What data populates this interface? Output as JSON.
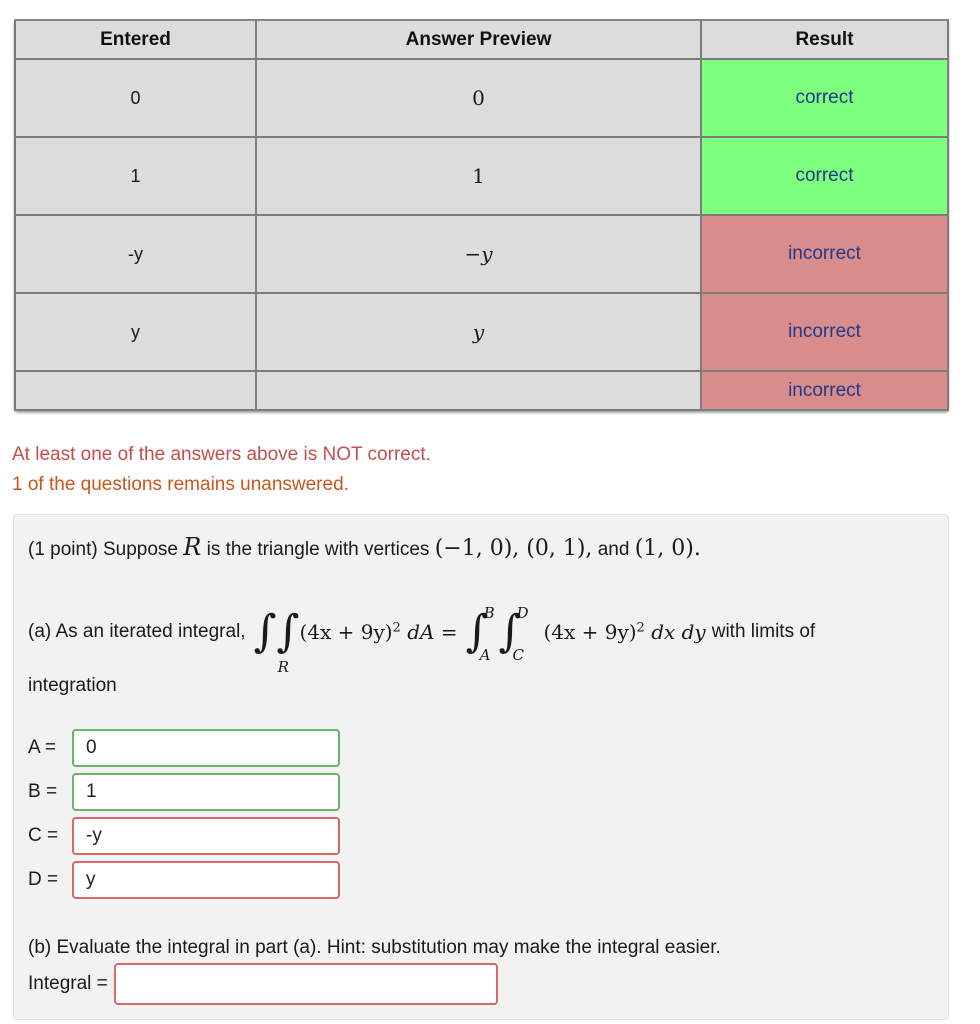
{
  "results_table": {
    "headers": [
      "Entered",
      "Answer Preview",
      "Result"
    ],
    "rows": [
      {
        "entered": "0",
        "preview": "0",
        "result": "correct",
        "status": "correct"
      },
      {
        "entered": "1",
        "preview": "1",
        "result": "correct",
        "status": "correct"
      },
      {
        "entered": "-y",
        "preview": "−y",
        "result": "incorrect",
        "status": "incorrect"
      },
      {
        "entered": "y",
        "preview": "y",
        "result": "incorrect",
        "status": "incorrect"
      },
      {
        "entered": "",
        "preview": "",
        "result": "incorrect",
        "status": "incorrect"
      }
    ]
  },
  "messages": {
    "not_correct": "At least one of the answers above is NOT correct.",
    "unanswered": "1 of the questions remains unanswered."
  },
  "problem": {
    "intro_prefix": "(1 point) Suppose ",
    "intro_var": "R",
    "intro_mid": " is the triangle with vertices ",
    "vertices_1": "(−1, 0), (0, 1),",
    "intro_and": " and ",
    "vertices_2": "(1, 0).",
    "part_a_prefix": "(a) As an iterated integral,",
    "integrand": "(4x + 9y)",
    "exponent": "2",
    "dA": "dA =",
    "region_label": "R",
    "outer_upper": "B",
    "outer_lower": "A",
    "inner_upper": "D",
    "inner_lower": "C",
    "dxdy": "dx dy",
    "part_a_suffix": "with limits of",
    "part_a_cont": "integration",
    "fields": [
      {
        "label": "A =",
        "value": "0",
        "status": "correct"
      },
      {
        "label": "B =",
        "value": "1",
        "status": "correct"
      },
      {
        "label": "C =",
        "value": "-y",
        "status": "incorrect"
      },
      {
        "label": "D =",
        "value": "y",
        "status": "incorrect"
      }
    ],
    "part_b": "(b) Evaluate the integral in part (a). Hint: substitution may make the integral easier.",
    "integral_label": "Integral =",
    "integral_value": ""
  },
  "colors": {
    "correct_bg": "#7fff7f",
    "incorrect_bg": "#d98c8c",
    "result_text": "#1f3a8a",
    "warn_text": "#c24e4e",
    "unanswered_text": "#c8561f"
  }
}
